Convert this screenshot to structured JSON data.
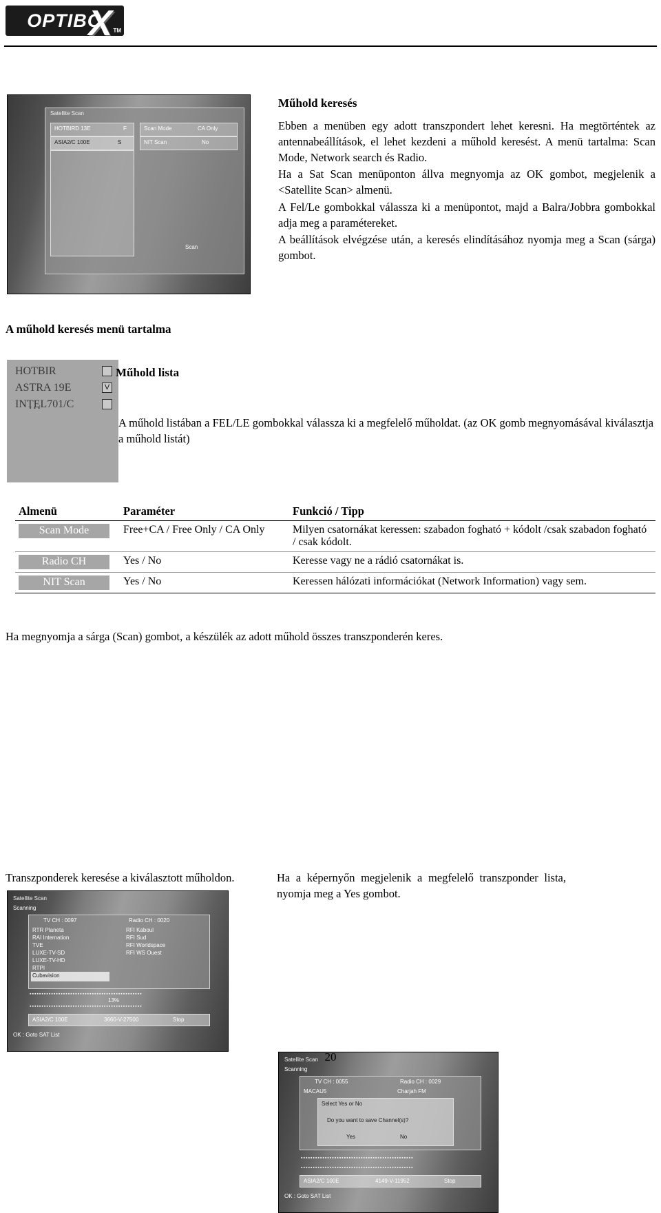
{
  "header": {
    "logo_text": "OPTIBO",
    "logo_x": "X",
    "logo_tm": "TM"
  },
  "intro": {
    "title": "Műhold keresés",
    "paragraphs": [
      "Ebben a menüben egy adott transzpondert lehet keresni. Ha megtörténtek az antennabeállítások, el lehet kezdeni a műhold keresést. A menü tartalma: Scan Mode, Network search és Radio.",
      "Ha a Sat Scan menüponton állva megnyomja az OK gombot, megjelenik a <Satellite Scan> almenü.",
      "A Fel/Le gombokkal válassza ki a menüpontot, majd a Balra/Jobbra gombokkal adja meg a paramétereket.",
      "A beállítások elvégzése után, a keresés elindításához nyomja meg a Scan (sárga) gombot."
    ]
  },
  "section_heading": "A műhold keresés menü tartalma",
  "satellite_list": {
    "items": [
      {
        "label": "HOTBIR",
        "checked": false
      },
      {
        "label": "ASTRA 19E",
        "checked": true
      },
      {
        "label": "INTEL701/C",
        "checked": false
      }
    ],
    "check_mark": "V",
    "ellipsis": "..."
  },
  "muhold_lista": {
    "label": "Műhold lista",
    "text": "A műhold listában a FEL/LE gombokkal válassza ki a megfelelő műholdat.   (az OK gomb megnyomásával kiválasztja a műhold listát)"
  },
  "table": {
    "headers": [
      "Almenü",
      "Paraméter",
      "Funkció / Tipp"
    ],
    "rows": [
      {
        "submenu": "Scan Mode",
        "parameter": "Free+CA / Free Only / CA Only",
        "function": "Milyen csatornákat keressen: szabadon fogható + kódolt /csak szabadon fogható / csak kódolt."
      },
      {
        "submenu": "Radio CH",
        "parameter": "Yes / No",
        "function": "Keresse vagy ne a rádió csatornákat is."
      },
      {
        "submenu": "NIT Scan",
        "parameter": "Yes / No",
        "function": "Keressen hálózati információkat (Network Information) vagy sem."
      }
    ]
  },
  "below_table_text": "Ha megnyomja a sárga (Scan) gombot, a készülék az adott műhold összes transzponderén keres.",
  "captions": {
    "left": "Transzponderek keresése a kiválasztott műholdon.",
    "right": "Ha a képernyőn megjelenik a megfelelő transzponder lista, nyomja meg a Yes gombot."
  },
  "screenshots": {
    "top": {
      "title": "Satellite Scan",
      "left_rows": [
        "HOTBIRD 13E",
        "ASIA2/C 100E"
      ],
      "left_flags": [
        "F",
        "S"
      ],
      "right_rows": [
        {
          "label": "Scan Mode",
          "value": "CA Only"
        },
        {
          "label": "NIT Scan",
          "value": "No"
        }
      ],
      "footer": "Scan"
    },
    "bottom_left": {
      "title": "Satellite Scan",
      "subtitle": "Scanning",
      "col_headers": [
        "TV CH : 0097",
        "Radio CH : 0020"
      ],
      "tv_list": [
        "RTR Planeta",
        "RAI Internation",
        "TVE",
        "LUXE-TV-SD",
        "LUXE-TV-HD",
        "RTPI",
        "Cubavision"
      ],
      "radio_list": [
        "RFI Kaboul",
        "RFI Sud",
        "RFI Worldspace",
        "RFI WS Ouest"
      ],
      "progress": "13%",
      "status_left": "ASIA2/C 100E",
      "status_mid": "3660-V-27500",
      "status_right": "Stop",
      "footer": "OK : Goto SAT List"
    },
    "bottom_right": {
      "title": "Satellite Scan",
      "subtitle": "Scanning",
      "col_headers": [
        "TV CH : 0055",
        "Radio CH : 0029"
      ],
      "tv_list": [
        "MACAU5"
      ],
      "radio_list": [
        "Charjah FM"
      ],
      "dialog_title": "Select Yes or No",
      "dialog_text": "Do you want to save Channel(s)?",
      "dialog_yes": "Yes",
      "dialog_no": "No",
      "status_left": "ASIA2/C 100E",
      "status_mid": "4149-V-11952",
      "status_right": "Stop",
      "footer": "OK : Goto SAT List"
    }
  },
  "page_number": "20"
}
